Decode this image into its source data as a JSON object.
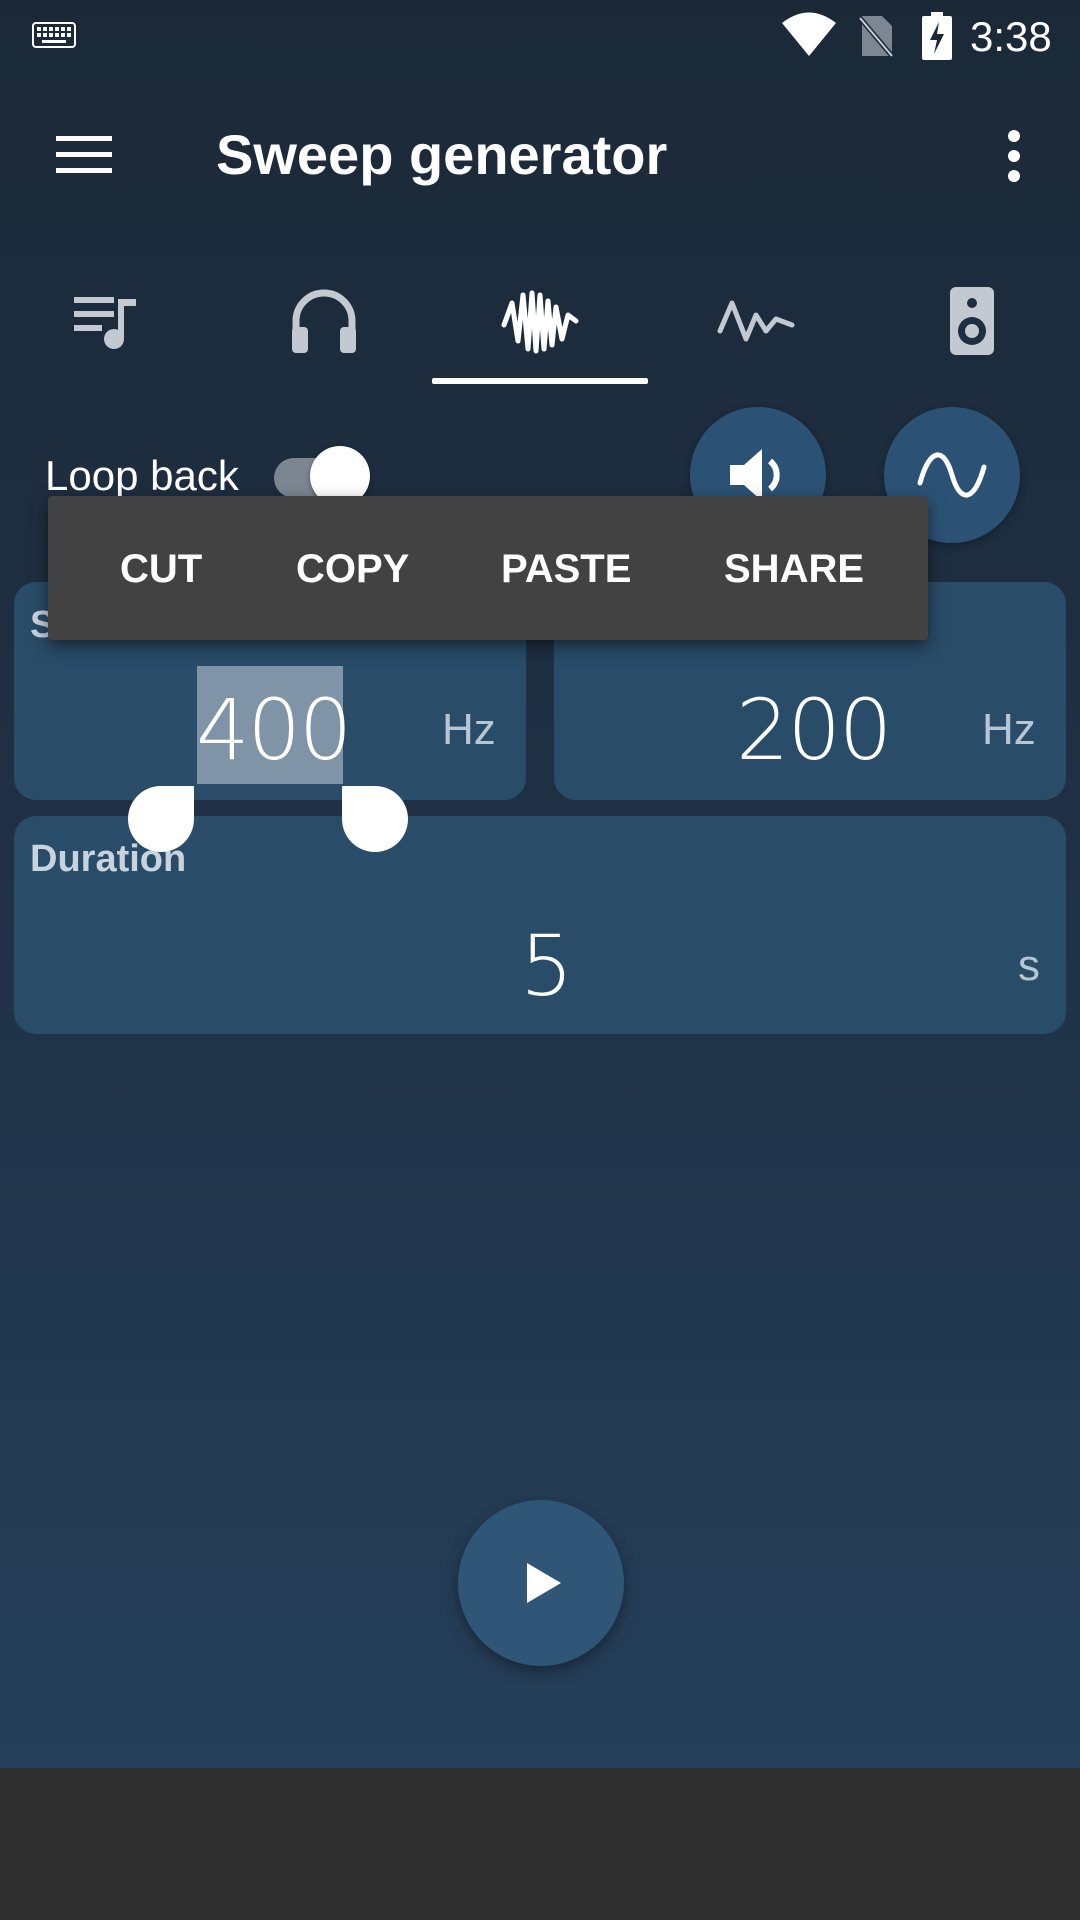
{
  "status_bar": {
    "time": "3:38",
    "icons": [
      "keyboard-icon",
      "wifi-icon",
      "no-sim-icon",
      "battery-charging-icon"
    ]
  },
  "toolbar": {
    "title": "Sweep generator",
    "menu_icon": "menu-icon",
    "overflow_icon": "more-vert-icon"
  },
  "tabs": [
    {
      "icon": "playlist-music-icon",
      "active": false
    },
    {
      "icon": "headphones-icon",
      "active": false
    },
    {
      "icon": "sweep-wave-icon",
      "active": true
    },
    {
      "icon": "pulse-wave-icon",
      "active": false
    },
    {
      "icon": "speaker-icon",
      "active": false
    }
  ],
  "controls": {
    "loop_back_label": "Loop back",
    "loop_back_enabled": true,
    "volume_icon": "volume-up-icon",
    "waveform_icon": "sine-wave-icon"
  },
  "fields": {
    "start": {
      "title": "S",
      "value": "400",
      "unit": "Hz"
    },
    "end": {
      "value": "200",
      "unit": "Hz"
    },
    "duration": {
      "title": "Duration",
      "value": "5",
      "unit": "s"
    }
  },
  "context_menu": {
    "items": [
      "CUT",
      "COPY",
      "PASTE",
      "SHARE"
    ]
  },
  "play_icon": "play-icon",
  "colors": {
    "background_top": "#1b2937",
    "background_bottom": "#253f59",
    "card": "#294c68",
    "button": "#2b5275",
    "menu": "#424242",
    "nav_bar": "#303030"
  }
}
